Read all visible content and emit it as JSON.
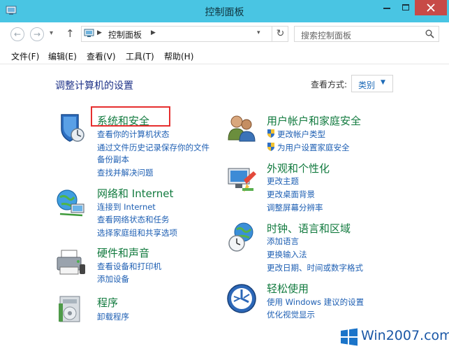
{
  "window": {
    "title": "控制面板"
  },
  "address": {
    "path": [
      "控制面板"
    ],
    "separator": "▶",
    "search_placeholder": "搜索控制面板"
  },
  "menu": [
    "文件(F)",
    "编辑(E)",
    "查看(V)",
    "工具(T)",
    "帮助(H)"
  ],
  "content": {
    "heading": "调整计算机的设置",
    "view_by_label": "查看方式:",
    "view_by_value": "类别"
  },
  "categories": {
    "system": {
      "title": "系统和安全",
      "links": [
        "查看你的计算机状态",
        "通过文件历史记录保存你的文件",
        "备份副本",
        "查找并解决问题"
      ]
    },
    "network": {
      "title": "网络和 Internet",
      "links": [
        "连接到 Internet",
        "查看网络状态和任务",
        "选择家庭组和共享选项"
      ]
    },
    "hardware": {
      "title": "硬件和声音",
      "links": [
        "查看设备和打印机",
        "添加设备"
      ]
    },
    "programs": {
      "title": "程序",
      "links": [
        "卸载程序"
      ]
    },
    "users": {
      "title": "用户帐户和家庭安全",
      "links": [
        "更改帐户类型",
        "为用户设置家庭安全"
      ]
    },
    "appearance": {
      "title": "外观和个性化",
      "links": [
        "更改主题",
        "更改桌面背景",
        "调整屏幕分辨率"
      ]
    },
    "clock": {
      "title": "时钟、语言和区域",
      "links": [
        "添加语言",
        "更换输入法",
        "更改日期、时间或数字格式"
      ]
    },
    "ease": {
      "title": "轻松使用",
      "links": [
        "使用 Windows 建议的设置",
        "优化视觉显示"
      ]
    }
  },
  "watermark": {
    "text": "Win2007.com"
  },
  "colors": {
    "titlebar": "#49c5e3",
    "close_button": "#c74a47",
    "category_title": "#117a3e",
    "link": "#1e5fb3",
    "heading": "#1e3287",
    "highlight": "#e62e2e"
  }
}
